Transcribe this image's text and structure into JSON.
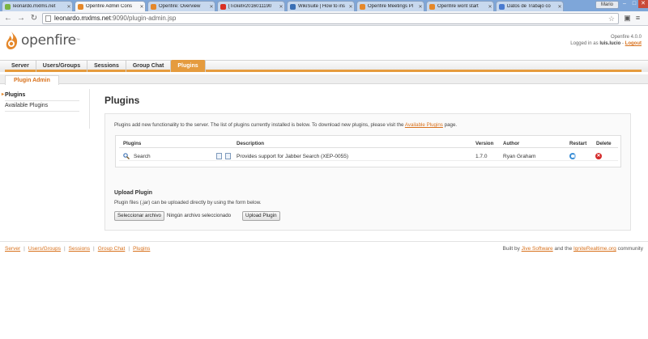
{
  "browser": {
    "tabs": [
      {
        "title": "leonardo.mxlms.net",
        "color": "#7bb342"
      },
      {
        "title": "Openfire Admin Cons",
        "color": "#e5882b",
        "active": true
      },
      {
        "title": "Openfire: Overview",
        "color": "#e5882b"
      },
      {
        "title": "[Ticket#2016011190",
        "color": "#d93025"
      },
      {
        "title": "WikiSuite | How to ins",
        "color": "#3a6fb5"
      },
      {
        "title": "Openfire Meetings Pl",
        "color": "#e5882b"
      },
      {
        "title": "Openfire wont start",
        "color": "#e5882b"
      },
      {
        "title": "Datos de Trabajo co",
        "color": "#4a7bd0"
      }
    ],
    "user_label": "Mario",
    "url_host": "leonardo.mxlms.net",
    "url_rest": ":9090/plugin-admin.jsp"
  },
  "header": {
    "logo_text": "openfire",
    "logo_tm": "™",
    "version": "Openfire 4.0.0",
    "logged_in_prefix": "Logged in as",
    "username": "luis.lucio",
    "logout": "Logout"
  },
  "mainnav": [
    "Server",
    "Users/Groups",
    "Sessions",
    "Group Chat",
    "Plugins"
  ],
  "subnav": "Plugin Admin",
  "sidebar": {
    "items": [
      "Plugins",
      "Available Plugins"
    ]
  },
  "page": {
    "title": "Plugins",
    "intro_before": "Plugins add new functionality to the server. The list of plugins currently installed is below. To download new plugins, please visit the",
    "intro_link": "Available Plugins",
    "intro_after": "page.",
    "table": {
      "headers": {
        "plugins": "Plugins",
        "description": "Description",
        "version": "Version",
        "author": "Author",
        "restart": "Restart",
        "delete": "Delete"
      },
      "rows": [
        {
          "name": "Search",
          "description": "Provides support for Jabber Search (XEP-0055)",
          "version": "1.7.0",
          "author": "Ryan Graham"
        }
      ]
    },
    "upload": {
      "title": "Upload Plugin",
      "desc": "Plugin files (.jar) can be uploaded directly by using the form below.",
      "file_button": "Seleccionar archivo",
      "no_file": "Ningún archivo seleccionado",
      "submit": "Upload Plugin"
    }
  },
  "footer": {
    "links": [
      "Server",
      "Users/Groups",
      "Sessions",
      "Group Chat",
      "Plugins"
    ],
    "built_by": "Built by",
    "jive": "Jive Software",
    "and_the": "and the",
    "ignite": "IgniteRealtime.org",
    "community": "community"
  },
  "colors": {
    "accent": "#e59b3e",
    "link": "#d8711c"
  }
}
